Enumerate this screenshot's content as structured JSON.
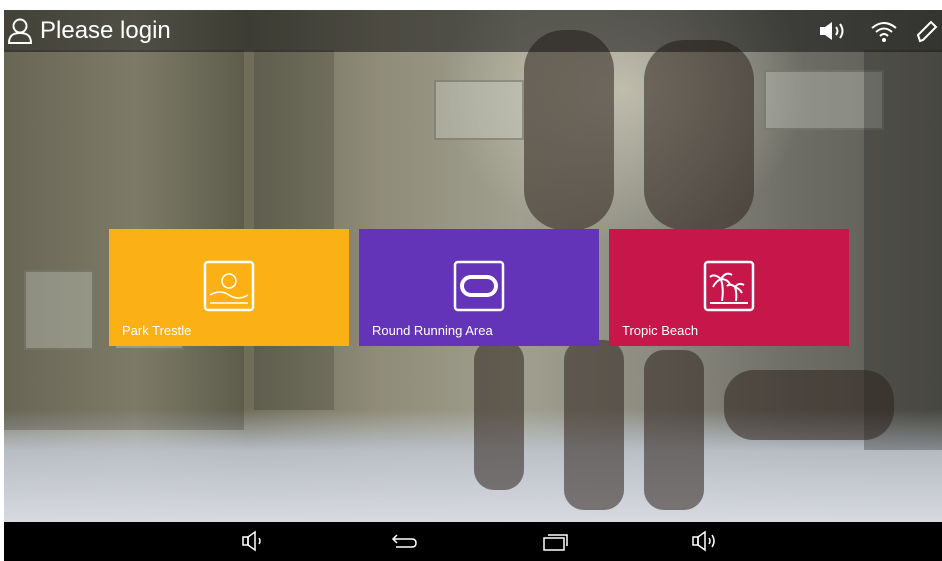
{
  "status_bar": {
    "login_text": "Please login",
    "icons": [
      "user-icon",
      "volume-icon",
      "wifi-icon",
      "pencil-icon"
    ]
  },
  "tiles": [
    {
      "label": "Park Trestle",
      "icon": "park-trestle-icon",
      "color": "#FBB115"
    },
    {
      "label": "Round Running Area",
      "icon": "round-track-icon",
      "color": "#6434B8"
    },
    {
      "label": "Tropic Beach",
      "icon": "palm-tree-icon",
      "color": "#C7164A"
    }
  ],
  "nav_bar": {
    "buttons": [
      "volume-down-icon",
      "back-icon",
      "recent-apps-icon",
      "volume-up-icon"
    ]
  }
}
